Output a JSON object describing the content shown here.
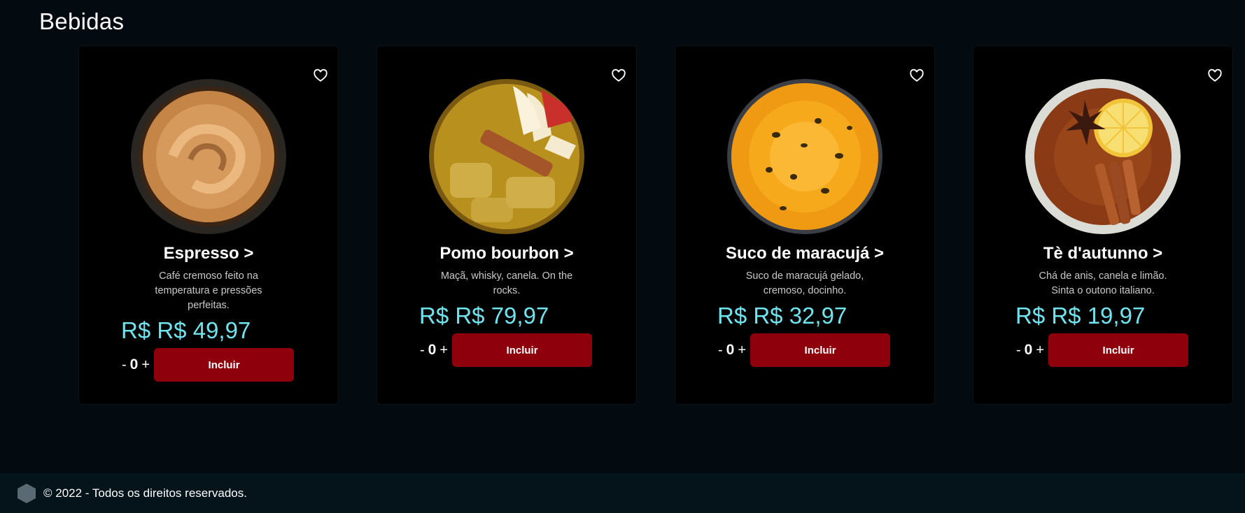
{
  "section": {
    "title": "Bebidas"
  },
  "products": [
    {
      "name": "Espresso >",
      "description": "Café cremoso feito na temperatura e pressões perfeitas.",
      "price": "R$ R$ 49,97",
      "quantity": "0",
      "button": "Incluir",
      "image_icon": "espresso-image"
    },
    {
      "name": "Pomo bourbon >",
      "description": "Maçã, whisky, canela. On the rocks.",
      "price": "R$ R$ 79,97",
      "quantity": "0",
      "button": "Incluir",
      "image_icon": "bourbon-image"
    },
    {
      "name": "Suco de maracujá >",
      "description": "Suco de maracujá gelado, cremoso, docinho.",
      "price": "R$ R$ 32,97",
      "quantity": "0",
      "button": "Incluir",
      "image_icon": "passion-fruit-juice-image"
    },
    {
      "name": "Tè d'autunno >",
      "description": "Chá de anis, canela e limão. Sinta o outono italiano.",
      "price": "R$ R$ 19,97",
      "quantity": "0",
      "button": "Incluir",
      "image_icon": "tea-image"
    }
  ],
  "controls": {
    "minus": "-",
    "plus": "+"
  },
  "footer": {
    "copyright": "© 2022 - Todos os direitos reservados."
  },
  "colors": {
    "background": "#030a10",
    "card": "#000000",
    "price": "#6fe3ee",
    "button": "#8f000d",
    "footer": "#04141a"
  }
}
